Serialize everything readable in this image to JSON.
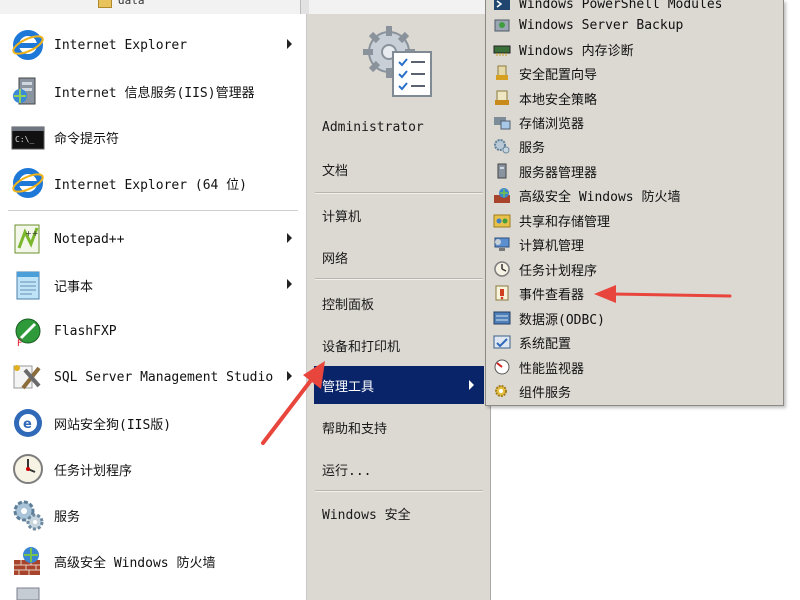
{
  "top_strip": {
    "folder_text": "data"
  },
  "programs": [
    {
      "label": "Internet Explorer",
      "icon": "ie-icon",
      "has_submenu": true
    },
    {
      "label": "Internet 信息服务(IIS)管理器",
      "icon": "iis-manager-icon",
      "has_submenu": false
    },
    {
      "label": "命令提示符",
      "icon": "cmd-icon",
      "has_submenu": false
    },
    {
      "label": "Internet Explorer (64 位)",
      "icon": "ie-icon",
      "has_submenu": false
    },
    {
      "label": "Notepad++",
      "icon": "notepadpp-icon",
      "has_submenu": true
    },
    {
      "label": "记事本",
      "icon": "notepad-icon",
      "has_submenu": true
    },
    {
      "label": "FlashFXP",
      "icon": "flashfxp-icon",
      "has_submenu": false
    },
    {
      "label": "SQL Server Management Studio",
      "icon": "sql-server-icon",
      "has_submenu": true
    },
    {
      "label": "网站安全狗(IIS版)",
      "icon": "safedog-icon",
      "has_submenu": false
    },
    {
      "label": "任务计划程序",
      "icon": "clock-icon",
      "has_submenu": false
    },
    {
      "label": "服务",
      "icon": "gears-icon",
      "has_submenu": false
    },
    {
      "label": "高级安全 Windows 防火墙",
      "icon": "firewall-icon",
      "has_submenu": false
    }
  ],
  "places": [
    {
      "label": "Administrator"
    },
    {
      "label": "文档"
    },
    {
      "label": "计算机"
    },
    {
      "label": "网络"
    },
    {
      "label": "控制面板"
    },
    {
      "label": "设备和打印机"
    },
    {
      "label": "管理工具"
    },
    {
      "label": "帮助和支持"
    },
    {
      "label": "运行..."
    },
    {
      "label": "Windows 安全"
    }
  ],
  "admin_tools": [
    {
      "label": "Windows PowerShell Modules",
      "icon": "powershell-icon"
    },
    {
      "label": "Windows Server Backup",
      "icon": "backup-icon"
    },
    {
      "label": "Windows 内存诊断",
      "icon": "memory-diagnostic-icon"
    },
    {
      "label": "安全配置向导",
      "icon": "security-wizard-icon"
    },
    {
      "label": "本地安全策略",
      "icon": "local-security-policy-icon"
    },
    {
      "label": "存储浏览器",
      "icon": "storage-explorer-icon"
    },
    {
      "label": "服务",
      "icon": "services-icon"
    },
    {
      "label": "服务器管理器",
      "icon": "server-manager-icon"
    },
    {
      "label": "高级安全 Windows 防火墙",
      "icon": "firewall-icon"
    },
    {
      "label": "共享和存储管理",
      "icon": "share-storage-icon"
    },
    {
      "label": "计算机管理",
      "icon": "computer-management-icon"
    },
    {
      "label": "任务计划程序",
      "icon": "task-scheduler-icon"
    },
    {
      "label": "事件查看器",
      "icon": "event-viewer-icon"
    },
    {
      "label": "数据源(ODBC)",
      "icon": "odbc-icon"
    },
    {
      "label": "系统配置",
      "icon": "system-config-icon"
    },
    {
      "label": "性能监视器",
      "icon": "performance-monitor-icon"
    },
    {
      "label": "组件服务",
      "icon": "component-services-icon"
    }
  ],
  "colors": {
    "menu_bg": "#dcd8d2",
    "highlight": "#0a246a",
    "annotation_red": "#e8453c"
  }
}
